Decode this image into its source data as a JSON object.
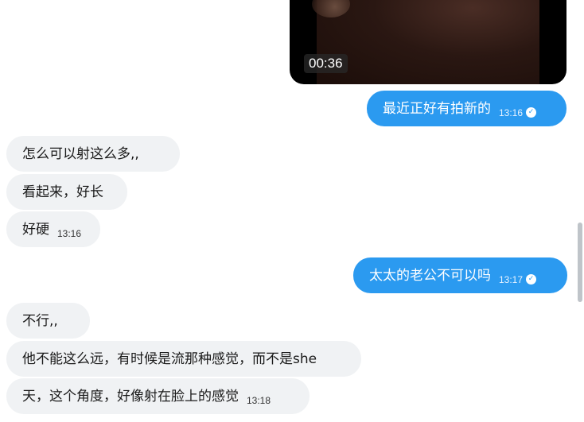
{
  "video": {
    "duration": "00:36"
  },
  "messages": [
    {
      "direction": "out",
      "text": "最近正好有拍新的",
      "time": "13:16",
      "read": true
    },
    {
      "direction": "in",
      "text": "怎么可以射这么多,,",
      "time": ""
    },
    {
      "direction": "in",
      "text": "看起来，好长",
      "time": ""
    },
    {
      "direction": "in",
      "text": "好硬",
      "time": "13:16"
    },
    {
      "direction": "out",
      "text": "太太的老公不可以吗",
      "time": "13:17",
      "read": true
    },
    {
      "direction": "in",
      "text": "不行,,",
      "time": ""
    },
    {
      "direction": "in",
      "text": "他不能这么远，有时候是流那种感觉，而不是she",
      "time": ""
    },
    {
      "direction": "in",
      "text": "天，这个角度，好像射在脸上的感觉",
      "time": "13:18"
    }
  ],
  "icons": {
    "read_check": "check-circle-icon"
  },
  "colors": {
    "outgoing_bubble": "#2b9af0",
    "incoming_bubble": "#f0f2f4"
  }
}
